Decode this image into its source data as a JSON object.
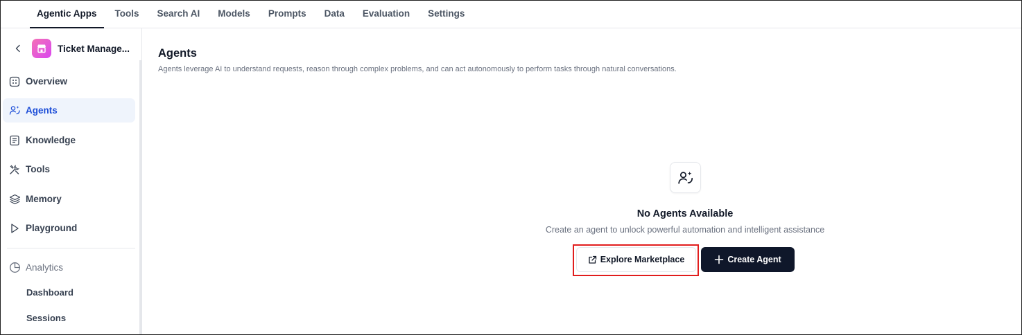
{
  "topnav": {
    "tabs": [
      {
        "label": "Agentic Apps",
        "active": true
      },
      {
        "label": "Tools",
        "active": false
      },
      {
        "label": "Search AI",
        "active": false
      },
      {
        "label": "Models",
        "active": false
      },
      {
        "label": "Prompts",
        "active": false
      },
      {
        "label": "Data",
        "active": false
      },
      {
        "label": "Evaluation",
        "active": false
      },
      {
        "label": "Settings",
        "active": false
      }
    ]
  },
  "sidebar": {
    "app_name": "Ticket Manage...",
    "items": [
      {
        "label": "Overview",
        "icon": "grid-icon"
      },
      {
        "label": "Agents",
        "icon": "agents-icon",
        "active": true
      },
      {
        "label": "Knowledge",
        "icon": "document-icon"
      },
      {
        "label": "Tools",
        "icon": "tools-icon"
      },
      {
        "label": "Memory",
        "icon": "layers-icon"
      },
      {
        "label": "Playground",
        "icon": "play-icon"
      }
    ],
    "analytics": {
      "label": "Analytics",
      "icon": "pie-chart-icon",
      "children": [
        "Dashboard",
        "Sessions"
      ]
    }
  },
  "main": {
    "title": "Agents",
    "description": "Agents leverage AI to understand requests, reason through complex problems, and can act autonomously to perform tasks through natural conversations.",
    "empty_state": {
      "icon": "agents-icon",
      "title": "No Agents Available",
      "subtitle": "Create an agent to unlock powerful automation and intelligent assistance",
      "explore_label": "Explore Marketplace",
      "create_label": "Create Agent"
    }
  },
  "colors": {
    "accent": "#1d4ed8",
    "active_bg": "#eff4fc",
    "primary_button": "#0f172a",
    "highlight": "#e11d1d"
  }
}
